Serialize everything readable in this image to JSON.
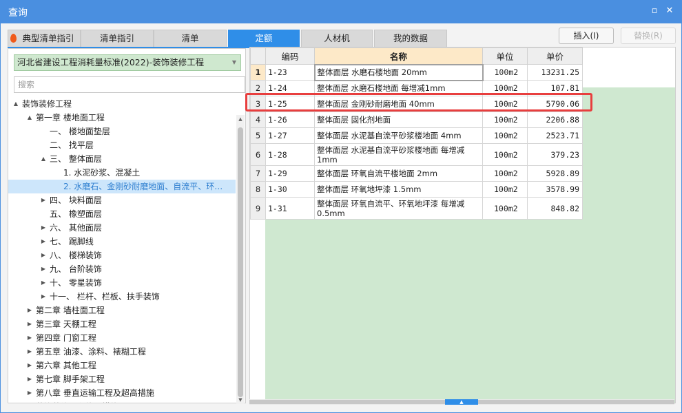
{
  "window": {
    "title": "查询",
    "restore_icon": "restore-icon",
    "close_icon": "close-icon"
  },
  "tabs": [
    {
      "label": "典型清单指引",
      "active": false
    },
    {
      "label": "清单指引",
      "active": false
    },
    {
      "label": "清单",
      "active": false
    },
    {
      "label": "定额",
      "active": true
    },
    {
      "label": "人材机",
      "active": false
    },
    {
      "label": "我的数据",
      "active": false
    }
  ],
  "buttons": {
    "insert": "插入(I)",
    "replace": "替换(R)"
  },
  "left_panel": {
    "library": "河北省建设工程消耗量标准(2022)-装饰装修工程",
    "search_placeholder": "搜索"
  },
  "tree": [
    {
      "label": "装饰装修工程",
      "arrow": "▲"
    },
    {
      "label": "第一章 楼地面工程",
      "arrow": "▲"
    },
    {
      "label": "一、 楼地面垫层",
      "arrow": ""
    },
    {
      "label": "二、 找平层",
      "arrow": ""
    },
    {
      "label": "三、 整体面层",
      "arrow": "▲"
    },
    {
      "label": "1. 水泥砂浆、混凝土",
      "arrow": ""
    },
    {
      "label": "2. 水磨石、金刚砂耐磨地面、自流平、环…",
      "arrow": "",
      "selected": true
    },
    {
      "label": "四、 块料面层",
      "arrow": "▶"
    },
    {
      "label": "五、 橡塑面层",
      "arrow": ""
    },
    {
      "label": "六、 其他面层",
      "arrow": "▶"
    },
    {
      "label": "七、 踢脚线",
      "arrow": "▶"
    },
    {
      "label": "八、 楼梯装饰",
      "arrow": "▶"
    },
    {
      "label": "九、 台阶装饰",
      "arrow": "▶"
    },
    {
      "label": "十、 零星装饰",
      "arrow": "▶"
    },
    {
      "label": "十一、 栏杆、栏板、扶手装饰",
      "arrow": "▶"
    },
    {
      "label": "第二章 墙柱面工程",
      "arrow": "▶"
    },
    {
      "label": "第三章 天棚工程",
      "arrow": "▶"
    },
    {
      "label": "第四章 门窗工程",
      "arrow": "▶"
    },
    {
      "label": "第五章 油漆、涂料、裱糊工程",
      "arrow": "▶"
    },
    {
      "label": "第六章 其他工程",
      "arrow": "▶"
    },
    {
      "label": "第七章 脚手架工程",
      "arrow": "▶"
    },
    {
      "label": "第八章 垂直运输工程及超高措施",
      "arrow": "▶"
    },
    {
      "label": "装饰装修工程施工措施项目",
      "arrow": "▶"
    }
  ],
  "table": {
    "headers": {
      "code": "编码",
      "name": "名称",
      "unit": "单位",
      "price": "单价"
    },
    "rows": [
      {
        "idx": "1",
        "code": "1-23",
        "name": "整体面层 水磨石楼地面 20mm",
        "unit": "100m2",
        "price": "13231.25"
      },
      {
        "idx": "2",
        "code": "1-24",
        "name": "整体面层 水磨石楼地面 每增减1mm",
        "unit": "100m2",
        "price": "107.81"
      },
      {
        "idx": "3",
        "code": "1-25",
        "name": "整体面层 金刚砂耐磨地面 40mm",
        "unit": "100m2",
        "price": "5790.06"
      },
      {
        "idx": "4",
        "code": "1-26",
        "name": "整体面层 固化剂地面",
        "unit": "100m2",
        "price": "2206.88"
      },
      {
        "idx": "5",
        "code": "1-27",
        "name": "整体面层 水泥基自流平砂浆楼地面 4mm",
        "unit": "100m2",
        "price": "2523.71"
      },
      {
        "idx": "6",
        "code": "1-28",
        "name": "整体面层 水泥基自流平砂浆楼地面 每增减1mm",
        "unit": "100m2",
        "price": "379.23"
      },
      {
        "idx": "7",
        "code": "1-29",
        "name": "整体面层 环氧自流平楼地面 2mm",
        "unit": "100m2",
        "price": "5928.89"
      },
      {
        "idx": "8",
        "code": "1-30",
        "name": "整体面层 环氧地坪漆 1.5mm",
        "unit": "100m2",
        "price": "3578.99"
      },
      {
        "idx": "9",
        "code": "1-31",
        "name": "整体面层 环氧自流平、环氧地坪漆 每增减0.5mm",
        "unit": "100m2",
        "price": "848.82"
      }
    ]
  }
}
